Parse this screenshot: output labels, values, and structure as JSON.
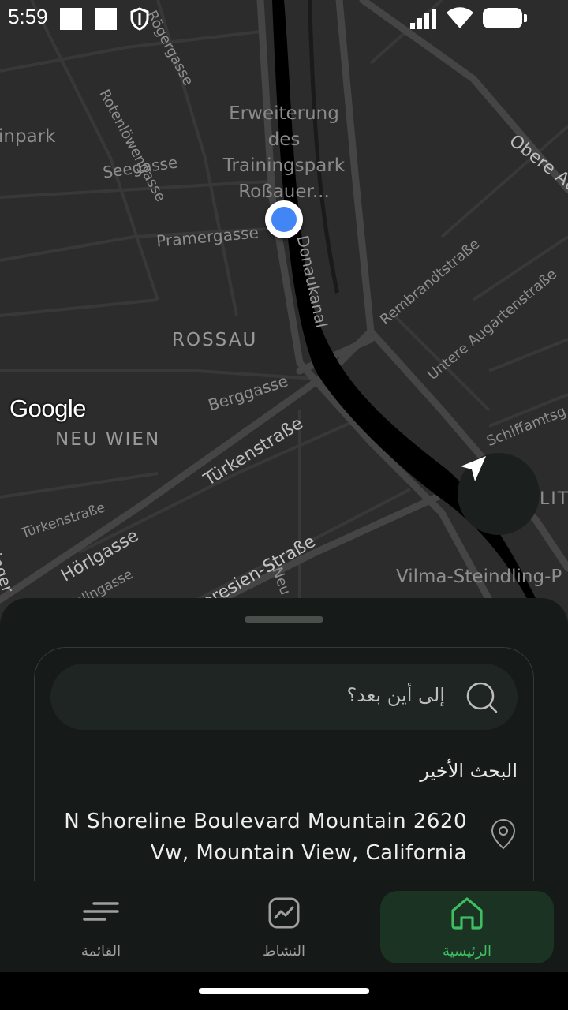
{
  "status_bar": {
    "time": "5:59",
    "icons": [
      "notification-square-icon",
      "notification-square-icon",
      "shield-icon",
      "signal-icon",
      "wifi-icon",
      "battery-icon"
    ]
  },
  "map": {
    "labels": {
      "park": "Erweiterung des Trainingspark Roßauer...",
      "park_line1": "Erweiterung",
      "park_line2": "des",
      "park_line3": "Trainingspark",
      "park_line4": "Roßauer...",
      "inpark": "inpark",
      "seegasse": "Seegasse",
      "rotenloewengasse": "Rotenlöwengasse",
      "roegergasse": "Rögergasse",
      "pramergasse": "Pramergasse",
      "donaukanal": "Donaukanal",
      "rossau": "ROSSAU",
      "berggasse": "Berggasse",
      "neu_wien": "NEU WIEN",
      "tuerkenstrasse": "Türkenstraße",
      "tuerkenstrasse_small": "Türkenstraße",
      "hoerlgasse": "Hörlgasse",
      "kolingasse": "Kolingasse",
      "maria_theresien": "ria-Theresien-Straße",
      "rembrandtstrasse": "Rembrandtstraße",
      "untere_augartenstrasse": "Untere Augartenstraße",
      "schiffamtsg": "Schiffamtsg",
      "obere_au": "Obere Au",
      "vilma": "Vilma-Steindling-P",
      "lit": "LIT",
      "sse": "sse",
      "ringer": "ringer",
      "neu": "Neu"
    },
    "logo": "Google",
    "colors": {
      "land": "#2c2c2c",
      "road": "#3f3f3f",
      "water": "#000000",
      "location": "#4285f4"
    }
  },
  "search": {
    "placeholder": "إلى أين بعد؟"
  },
  "recent": {
    "title": "البحث الأخير",
    "items": [
      {
        "address": "N Shoreline Boulevard Mountain 2620 Vw, Mountain View, California"
      }
    ]
  },
  "nav": {
    "items": [
      {
        "label": "القائمة",
        "icon": "menu-icon",
        "active": false
      },
      {
        "label": "النشاط",
        "icon": "activity-icon",
        "active": false
      },
      {
        "label": "الرئيسية",
        "icon": "home-icon",
        "active": true
      }
    ],
    "accent": "#3fbd63"
  }
}
